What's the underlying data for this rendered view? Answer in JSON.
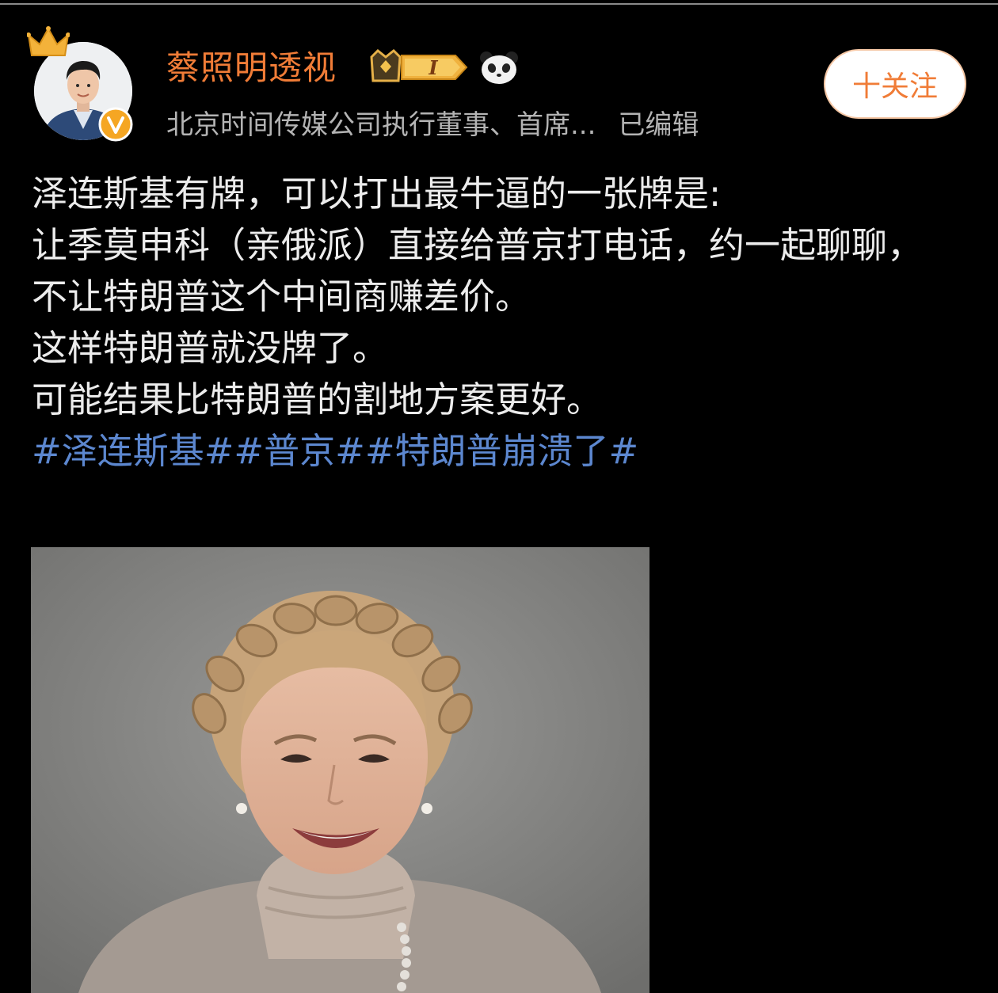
{
  "header": {
    "username": "蔡照明透视",
    "level_text": "I",
    "bio": "北京时间传媒公司执行董事、首席...",
    "edited_label": "已编辑",
    "follow_label": "十关注"
  },
  "post": {
    "lines": [
      "泽连斯基有牌，可以打出最牛逼的一张牌是:",
      "让季莫申科（亲俄派）直接给普京打电话，约一起聊聊，",
      "不让特朗普这个中间商赚差价。",
      "这样特朗普就没牌了。",
      "可能结果比特朗普的割地方案更好。"
    ],
    "hashtags": [
      "#泽连斯基#",
      "#普京#",
      "#特朗普崩溃了#"
    ]
  },
  "colors": {
    "background": "#000000",
    "username": "#f07c37",
    "hashtag": "#5c87cf",
    "follow_border": "#f5c7a5"
  },
  "icons": [
    "crown-icon",
    "verified-icon",
    "level-badge-icon",
    "panda-icon"
  ]
}
